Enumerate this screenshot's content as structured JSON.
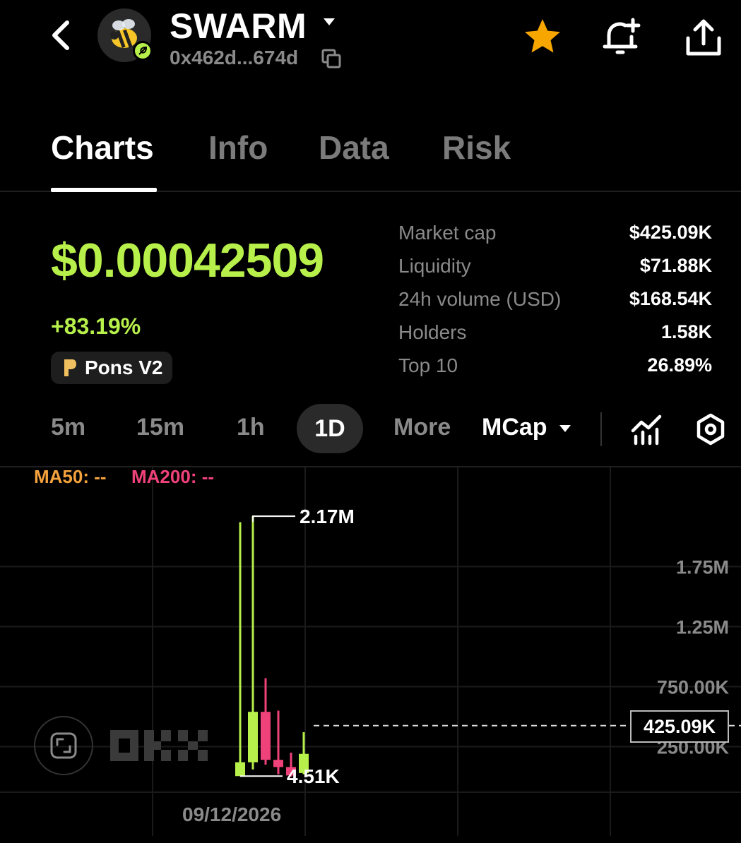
{
  "header": {
    "token_name": "SWARM",
    "address": "0x462d...674d",
    "icons": [
      "back-icon",
      "bee-avatar",
      "caret-down-icon",
      "copy-icon",
      "star-icon",
      "bell-plus-icon",
      "share-icon"
    ],
    "favorite_color": "#f7a600"
  },
  "tabs": [
    {
      "label": "Charts",
      "active": true
    },
    {
      "label": "Info",
      "active": false
    },
    {
      "label": "Data",
      "active": false
    },
    {
      "label": "Risk",
      "active": false
    }
  ],
  "price": {
    "value": "$0.00042509",
    "change": "+83.19%",
    "dex": "Pons V2",
    "accent_color": "#b7f04a"
  },
  "stats": [
    {
      "label": "Market cap",
      "value": "$425.09K"
    },
    {
      "label": "Liquidity",
      "value": "$71.88K"
    },
    {
      "label": "24h volume (USD)",
      "value": "$168.54K"
    },
    {
      "label": "Holders",
      "value": "1.58K"
    },
    {
      "label": "Top 10",
      "value": "26.89%"
    }
  ],
  "timeframes": {
    "items": [
      "5m",
      "15m",
      "1h",
      "1D",
      "More"
    ],
    "active": "1D",
    "metric": "MCap"
  },
  "indicators": {
    "ma50": "MA50: --",
    "ma200": "MA200: --",
    "ma50_color": "#f4a23c",
    "ma200_color": "#f0427a"
  },
  "chart_data": {
    "type": "candlestick",
    "up_color": "#b7f04a",
    "down_color": "#f0427a",
    "y_ticks": [
      "1.75M",
      "1.25M",
      "750.00K",
      "250.00K"
    ],
    "y_tick_values": [
      1750000,
      1250000,
      750000,
      250000
    ],
    "current_value_label": "425.09K",
    "current_value": 425090,
    "high_label": "2.17M",
    "low_label": "4.51K",
    "x_label": "09/12/2026",
    "candles": [
      {
        "open": 4510,
        "close": 120000,
        "high": 2120000,
        "low": 4510,
        "dir": "up"
      },
      {
        "open": 120000,
        "close": 540000,
        "high": 2170000,
        "low": 60000,
        "dir": "up"
      },
      {
        "open": 540000,
        "close": 140000,
        "high": 820000,
        "low": 100000,
        "dir": "down"
      },
      {
        "open": 140000,
        "close": 80000,
        "high": 550000,
        "low": 20000,
        "dir": "down"
      },
      {
        "open": 80000,
        "close": 10000,
        "high": 200000,
        "low": 0,
        "dir": "down"
      },
      {
        "open": 30000,
        "close": 190000,
        "high": 370000,
        "low": 20000,
        "dir": "up"
      }
    ]
  },
  "watermark": "OKX"
}
